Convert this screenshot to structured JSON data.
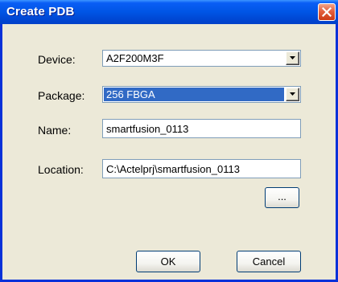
{
  "dialog": {
    "title": "Create PDB"
  },
  "form": {
    "device": {
      "label": "Device:",
      "value": "A2F200M3F"
    },
    "package": {
      "label": "Package:",
      "value": "256 FBGA"
    },
    "name": {
      "label": "Name:",
      "value": "smartfusion_0113"
    },
    "location": {
      "label": "Location:",
      "value": "C:\\Actelprj\\smartfusion_0113"
    }
  },
  "buttons": {
    "browse": "...",
    "ok": "OK",
    "cancel": "Cancel"
  },
  "icons": {
    "close": "close-icon",
    "dropdown": "chevron-down-icon"
  },
  "colors": {
    "titlebar": "#0055e5",
    "window_border": "#0831d9",
    "dialog_bg": "#ece9d8",
    "selection": "#316ac5",
    "close_button": "#e3603e"
  }
}
